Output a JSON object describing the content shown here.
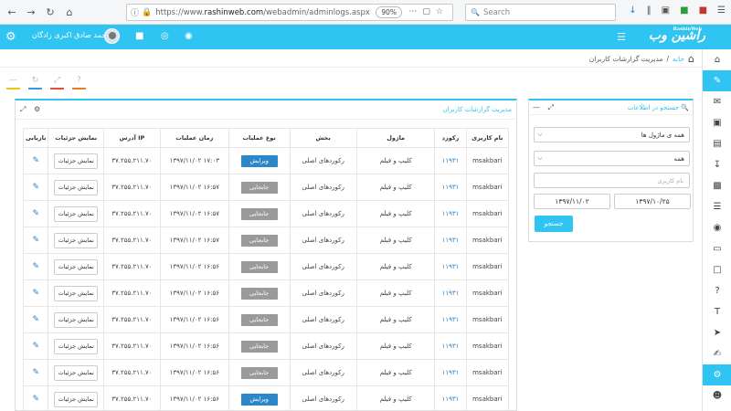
{
  "browser": {
    "url_prefix": "https://www.",
    "url_domain": "rashinweb.com",
    "url_path": "/webadmin/adminlogs.aspx",
    "zoom": "90%",
    "search_placeholder": "Search"
  },
  "header": {
    "user_name": "محمد صادق اکبری زادگان",
    "logo_text": "راشین وب",
    "logo_small": "RashinWeb"
  },
  "breadcrumb": {
    "home": "خانه",
    "separator": "/",
    "current": "مدیریت گزارشات کاربران"
  },
  "search_panel": {
    "title": "جستجو در اطلاعات",
    "module_select": "همه ی ماژول ها",
    "type_select": "همه",
    "username_placeholder": "نام کاربری",
    "date_from": "۱۳۹۷/۱۰/۲۵",
    "date_to": "۱۳۹۷/۱۱/۰۲",
    "search_button": "جستجو"
  },
  "logs_panel": {
    "title": "مدیریت گزارشات کاربران",
    "columns": [
      "نام کاربری",
      "رکورد",
      "ماژول",
      "بخش",
      "نوع عملیات",
      "زمان عملیات",
      "آدرس IP",
      "نمایش جزئیات",
      "بازیابی"
    ],
    "rows": [
      {
        "user": "msakbari",
        "record": "۱۱۹۳۱",
        "module": "کلیپ و فیلم",
        "section": "رکوردهای اصلی",
        "op": "ویرایش",
        "op_type": "edit",
        "time": "۱۳۹۷/۱۱/۰۲  ۱۷:۰۳",
        "ip": "۳۷.۲۵۵.۲۱۱.۷۰",
        "details": "نمایش جزئیات"
      },
      {
        "user": "msakbari",
        "record": "۱۱۹۳۱",
        "module": "کلیپ و فیلم",
        "section": "رکوردهای اصلی",
        "op": "جابجایی",
        "op_type": "move",
        "time": "۱۳۹۷/۱۱/۰۲  ۱۶:۵۷",
        "ip": "۳۷.۲۵۵.۲۱۱.۷۰",
        "details": "نمایش جزئیات"
      },
      {
        "user": "msakbari",
        "record": "۱۱۹۳۱",
        "module": "کلیپ و فیلم",
        "section": "رکوردهای اصلی",
        "op": "جابجایی",
        "op_type": "move",
        "time": "۱۳۹۷/۱۱/۰۲  ۱۶:۵۷",
        "ip": "۳۷.۲۵۵.۲۱۱.۷۰",
        "details": "نمایش جزئیات"
      },
      {
        "user": "msakbari",
        "record": "۱۱۹۳۱",
        "module": "کلیپ و فیلم",
        "section": "رکوردهای اصلی",
        "op": "جابجایی",
        "op_type": "move",
        "time": "۱۳۹۷/۱۱/۰۲  ۱۶:۵۷",
        "ip": "۳۷.۲۵۵.۲۱۱.۷۰",
        "details": "نمایش جزئیات"
      },
      {
        "user": "msakbari",
        "record": "۱۱۹۳۱",
        "module": "کلیپ و فیلم",
        "section": "رکوردهای اصلی",
        "op": "جابجایی",
        "op_type": "move",
        "time": "۱۳۹۷/۱۱/۰۲  ۱۶:۵۶",
        "ip": "۳۷.۲۵۵.۲۱۱.۷۰",
        "details": "نمایش جزئیات"
      },
      {
        "user": "msakbari",
        "record": "۱۱۹۳۱",
        "module": "کلیپ و فیلم",
        "section": "رکوردهای اصلی",
        "op": "جابجایی",
        "op_type": "move",
        "time": "۱۳۹۷/۱۱/۰۲  ۱۶:۵۶",
        "ip": "۳۷.۲۵۵.۲۱۱.۷۰",
        "details": "نمایش جزئیات"
      },
      {
        "user": "msakbari",
        "record": "۱۱۹۳۱",
        "module": "کلیپ و فیلم",
        "section": "رکوردهای اصلی",
        "op": "جابجایی",
        "op_type": "move",
        "time": "۱۳۹۷/۱۱/۰۲  ۱۶:۵۶",
        "ip": "۳۷.۲۵۵.۲۱۱.۷۰",
        "details": "نمایش جزئیات"
      },
      {
        "user": "msakbari",
        "record": "۱۱۹۳۱",
        "module": "کلیپ و فیلم",
        "section": "رکوردهای اصلی",
        "op": "جابجایی",
        "op_type": "move",
        "time": "۱۳۹۷/۱۱/۰۲  ۱۶:۵۶",
        "ip": "۳۷.۲۵۵.۲۱۱.۷۰",
        "details": "نمایش جزئیات"
      },
      {
        "user": "msakbari",
        "record": "۱۱۹۳۱",
        "module": "کلیپ و فیلم",
        "section": "رکوردهای اصلی",
        "op": "جابجایی",
        "op_type": "move",
        "time": "۱۳۹۷/۱۱/۰۲  ۱۶:۵۶",
        "ip": "۳۷.۲۵۵.۲۱۱.۷۰",
        "details": "نمایش جزئیات"
      },
      {
        "user": "msakbari",
        "record": "۱۱۹۳۱",
        "module": "کلیپ و فیلم",
        "section": "رکوردهای اصلی",
        "op": "ویرایش",
        "op_type": "edit",
        "time": "۱۳۹۷/۱۱/۰۲  ۱۶:۵۶",
        "ip": "۳۷.۲۵۵.۲۱۱.۷۰",
        "details": "نمایش جزئیات"
      }
    ]
  },
  "colors": {
    "accent": "#2fc4f2",
    "edit_tag": "#2b87c9",
    "move_tag": "#9a9a9a",
    "link": "#2a7fc6"
  }
}
